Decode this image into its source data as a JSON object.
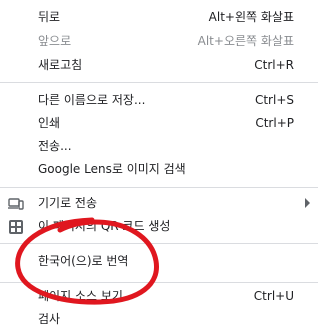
{
  "menu": {
    "items": [
      {
        "label": "뒤로",
        "shortcut": "Alt+왼쪽 화살표",
        "enabled": true
      },
      {
        "label": "앞으로",
        "shortcut": "Alt+오른쪽 화살표",
        "enabled": false
      },
      {
        "label": "새로고침",
        "shortcut": "Ctrl+R",
        "enabled": true
      },
      {
        "label": "다른 이름으로 저장...",
        "shortcut": "Ctrl+S",
        "enabled": true
      },
      {
        "label": "인쇄",
        "shortcut": "Ctrl+P",
        "enabled": true
      },
      {
        "label": "전송...",
        "shortcut": "",
        "enabled": true
      },
      {
        "label": "Google Lens로 이미지 검색",
        "shortcut": "",
        "enabled": true
      },
      {
        "label": "기기로 전송",
        "shortcut": "",
        "enabled": true,
        "icon": "device-icon",
        "submenu": true
      },
      {
        "label": "이 페이지의 QR 코드 생성",
        "shortcut": "",
        "enabled": true,
        "icon": "qr-code-icon"
      },
      {
        "label": "한국어(으)로 번역",
        "shortcut": "",
        "enabled": true
      },
      {
        "label": "페이지 소스 보기",
        "shortcut": "Ctrl+U",
        "enabled": true
      },
      {
        "label": "검사",
        "shortcut": "",
        "enabled": true
      }
    ]
  },
  "annotation": {
    "shape": "red-ellipse",
    "color": "#e0171f",
    "target_item": "한국어(으)로 번역"
  }
}
